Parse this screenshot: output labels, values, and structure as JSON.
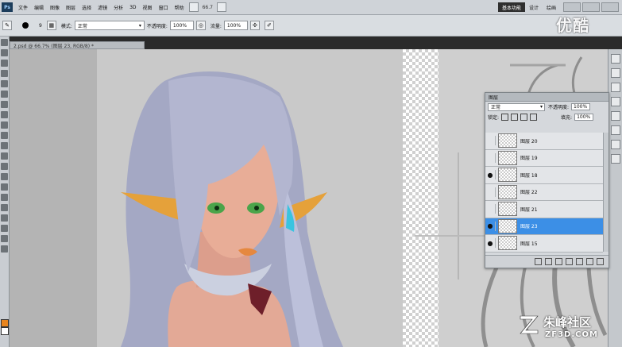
{
  "menubar": {
    "logo": "Ps",
    "items": [
      "文件",
      "编辑",
      "图像",
      "图层",
      "选择",
      "滤镜",
      "分析",
      "3D",
      "视图",
      "窗口",
      "帮助"
    ],
    "zoom": "66.7",
    "workspace_active": "基本功能",
    "workspace_other": "设计",
    "workspace_more": "绘画"
  },
  "options": {
    "brush_size": "9",
    "mode_label": "模式:",
    "mode_value": "正常",
    "opacity_label": "不透明度:",
    "opacity_value": "100%",
    "flow_label": "流量:",
    "flow_value": "100%"
  },
  "document": {
    "tab": "2.psd @ 66.7% (图层 23, RGB/8) *"
  },
  "layers_panel": {
    "title": "图层",
    "blend_mode": "正常",
    "opacity_label": "不透明度:",
    "opacity_value": "100%",
    "lock_label": "锁定:",
    "fill_label": "填充:",
    "fill_value": "100%",
    "layers": [
      {
        "name": "图层 20",
        "visible": false,
        "selected": false
      },
      {
        "name": "图层 19",
        "visible": false,
        "selected": false
      },
      {
        "name": "图层 18",
        "visible": true,
        "selected": false
      },
      {
        "name": "图层 22",
        "visible": false,
        "selected": false
      },
      {
        "name": "图层 21",
        "visible": false,
        "selected": false
      },
      {
        "name": "图层 23",
        "visible": true,
        "selected": true
      },
      {
        "name": "图层 15",
        "visible": true,
        "selected": false
      }
    ]
  },
  "watermarks": {
    "top": "优酷",
    "bottom_cn": "朱峰社区",
    "bottom_en": "ZF3D.COM"
  },
  "colors": {
    "foreground": "#e8851e",
    "background": "#ffffff",
    "selection": "#3c8fe6"
  }
}
